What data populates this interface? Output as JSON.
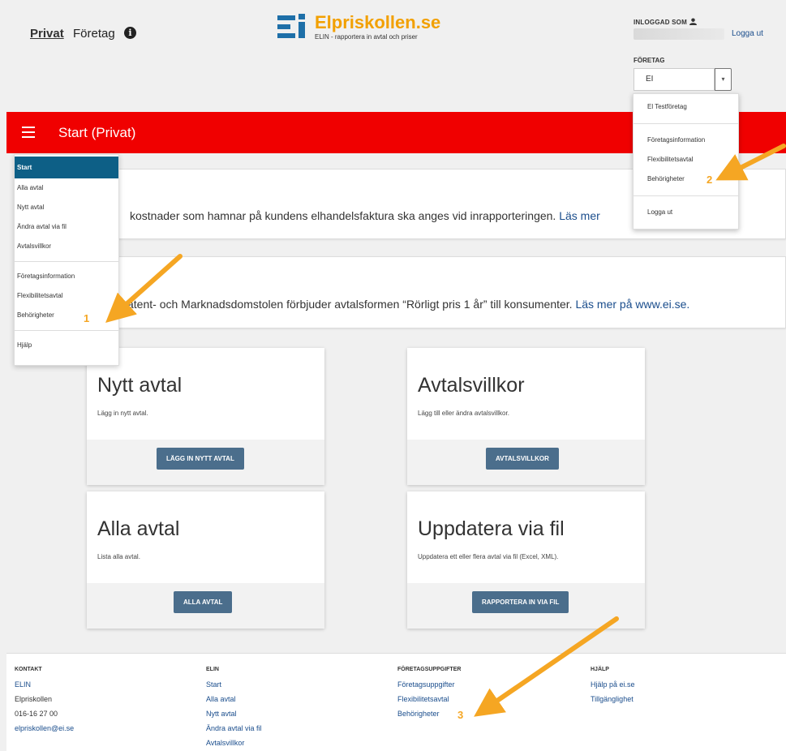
{
  "header": {
    "nav": {
      "privat": "Privat",
      "foretag": "Företag"
    },
    "logo": {
      "title": "Elpriskollen.se",
      "subtitle": "ELIN - rapportera in avtal och priser"
    },
    "user": {
      "label": "INLOGGAD SOM",
      "logout": "Logga ut"
    },
    "company": {
      "label": "FÖRETAG",
      "selected": "EI TESTFÖRETAG"
    }
  },
  "page": {
    "title": "Start (Privat)"
  },
  "notices": [
    {
      "text": "kostnader som hamnar på kundens elhandelsfaktura ska anges vid inrapporteringen.",
      "link": "Läs mer"
    },
    {
      "text": "atent- och Marknadsdomstolen förbjuder avtalsformen “Rörligt pris 1 år” till konsumenter.",
      "link": "Läs mer på www.ei.se."
    }
  ],
  "cards": [
    {
      "title": "Nytt avtal",
      "desc": "Lägg in nytt avtal.",
      "button": "LÄGG IN NYTT AVTAL"
    },
    {
      "title": "Avtalsvillkor",
      "desc": "Lägg till eller ändra avtalsvillkor.",
      "button": "AVTALSVILLKOR"
    },
    {
      "title": "Alla avtal",
      "desc": "Lista alla avtal.",
      "button": "ALLA AVTAL"
    },
    {
      "title": "Uppdatera via fil",
      "desc": "Uppdatera ett eller flera avtal via fil (Excel, XML).",
      "button": "RAPPORTERA IN VIA FIL"
    }
  ],
  "left_menu": {
    "items": [
      "Start",
      "Alla avtal",
      "Nytt avtal",
      "Ändra avtal via fil",
      "Avtalsvillkor"
    ],
    "items2": [
      "Företagsinformation",
      "Flexibilitetsavtal",
      "Behörigheter"
    ],
    "items3": [
      "Hjälp"
    ]
  },
  "right_menu": {
    "items": [
      "El Testföretag"
    ],
    "items2": [
      "Företagsinformation",
      "Flexibilitetsavtal",
      "Behörigheter"
    ],
    "items3": [
      "Logga ut"
    ]
  },
  "footer": {
    "kontakt": {
      "head": "KONTAKT",
      "items": [
        "ELIN",
        "Elpriskollen",
        "016-16 27 00",
        "elpriskollen@ei.se"
      ]
    },
    "elin": {
      "head": "ELIN",
      "items": [
        "Start",
        "Alla avtal",
        "Nytt avtal",
        "Ändra avtal via fil",
        "Avtalsvillkor"
      ]
    },
    "foretag": {
      "head": "FÖRETAGSUPPGIFTER",
      "items": [
        "Företagsuppgifter",
        "Flexibilitetsavtal",
        "Behörigheter"
      ]
    },
    "hjalp": {
      "head": "HJÄLP",
      "items": [
        "Hjälp på ei.se",
        "Tillgänglighet"
      ]
    }
  },
  "annotations": [
    "1",
    "2",
    "3"
  ],
  "colors": {
    "red_bar": "#f00000",
    "active_menu": "#0d5f86",
    "button": "#4b6e8c",
    "link": "#1a4d8c",
    "logo_orange": "#f2a000",
    "logo_blue": "#1e6fa8",
    "arrow": "#f5a623"
  }
}
